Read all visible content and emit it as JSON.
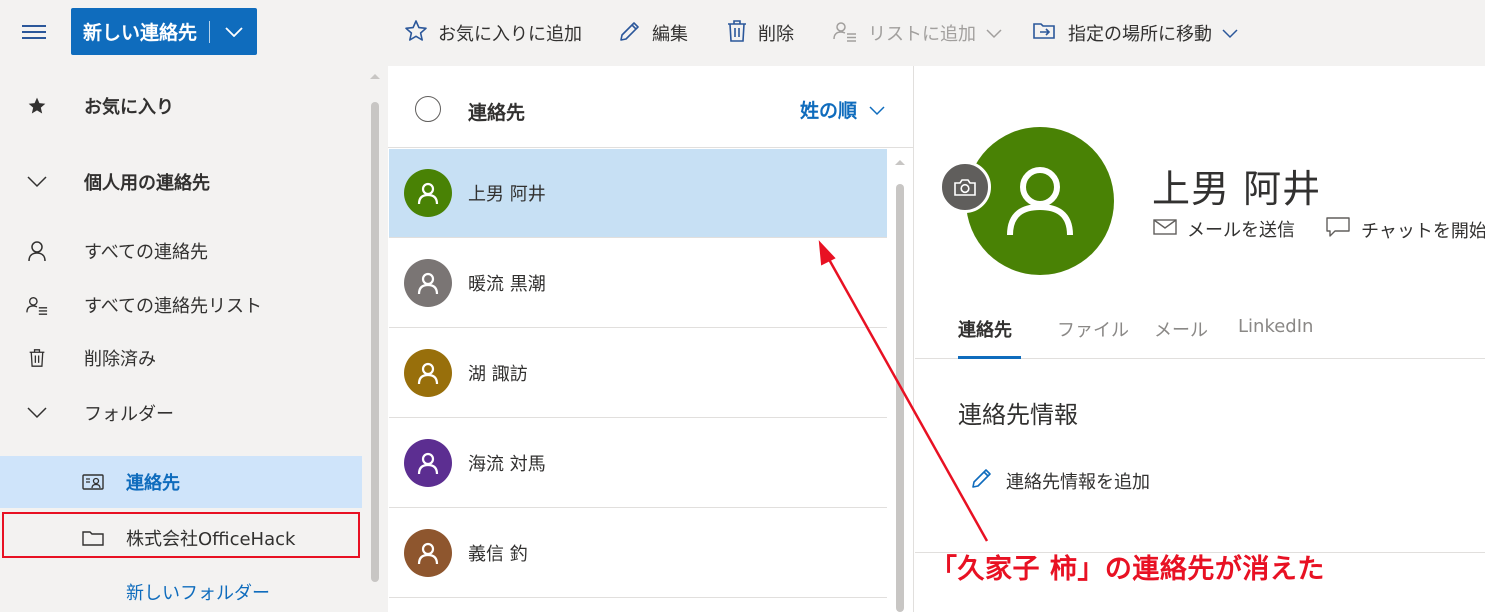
{
  "toolbar": {
    "new_contact_label": "新しい連絡先",
    "favorite_label": "お気に入りに追加",
    "edit_label": "編集",
    "delete_label": "削除",
    "add_to_list_label": "リストに追加",
    "move_to_label": "指定の場所に移動"
  },
  "sidebar": {
    "favorites": "お気に入り",
    "personal_contacts": "個人用の連絡先",
    "all_contacts": "すべての連絡先",
    "all_contact_lists": "すべての連絡先リスト",
    "deleted": "削除済み",
    "folders": "フォルダー",
    "folder_contacts": "連絡先",
    "folder_company": "株式会社OfficeHack",
    "new_folder": "新しいフォルダー"
  },
  "list": {
    "header": "連絡先",
    "sort_label": "姓の順",
    "contacts": [
      {
        "name": "上男 阿井",
        "color": "#498205"
      },
      {
        "name": "暖流 黒潮",
        "color": "#7a7574"
      },
      {
        "name": "湖 諏訪",
        "color": "#986f0b"
      },
      {
        "name": "海流 対馬",
        "color": "#5c2e91"
      },
      {
        "name": "義信 釣",
        "color": "#8e562e"
      }
    ]
  },
  "detail": {
    "name": "上男 阿井",
    "avatar_color": "#498205",
    "send_mail": "メールを送信",
    "start_chat": "チャットを開始",
    "tabs": [
      "連絡先",
      "ファイル",
      "メール",
      "LinkedIn"
    ],
    "section_title": "連絡先情報",
    "add_info": "連絡先情報を追加"
  },
  "annotation": {
    "text": "「久家子 柿」の連絡先が消えた",
    "color": "#e81123"
  },
  "colors": {
    "accent": "#0f6cbd",
    "selected_row": "#c7e0f4",
    "selected_nav": "#cfe4fa"
  }
}
